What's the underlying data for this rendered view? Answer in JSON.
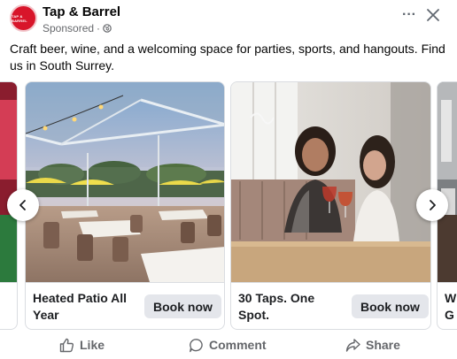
{
  "header": {
    "page_name": "Tap & Barrel",
    "avatar_text": "TAP & BARREL",
    "sponsored_label": "Sponsored",
    "more_label": "···"
  },
  "post": {
    "caption": "Craft beer, wine, and a welcoming space for parties, sports, and hangouts. Find us in South Surrey."
  },
  "carousel": {
    "cards": [
      {
        "title": "Heated Patio All Year",
        "cta": "Book now",
        "image": "patio-photo"
      },
      {
        "title": "30 Taps. One Spot.",
        "cta": "Book now",
        "image": "friends-toasting-photo"
      },
      {
        "title": "W G",
        "cta": "",
        "image": "partial-photo"
      }
    ],
    "prev_icon": "chevron-left-icon",
    "next_icon": "chevron-right-icon"
  },
  "actions": {
    "like": "Like",
    "comment": "Comment",
    "share": "Share"
  },
  "colors": {
    "brand": "#d8152a",
    "secondary_text": "#65676b",
    "button_bg": "#e4e6eb",
    "border": "#dadde1"
  }
}
